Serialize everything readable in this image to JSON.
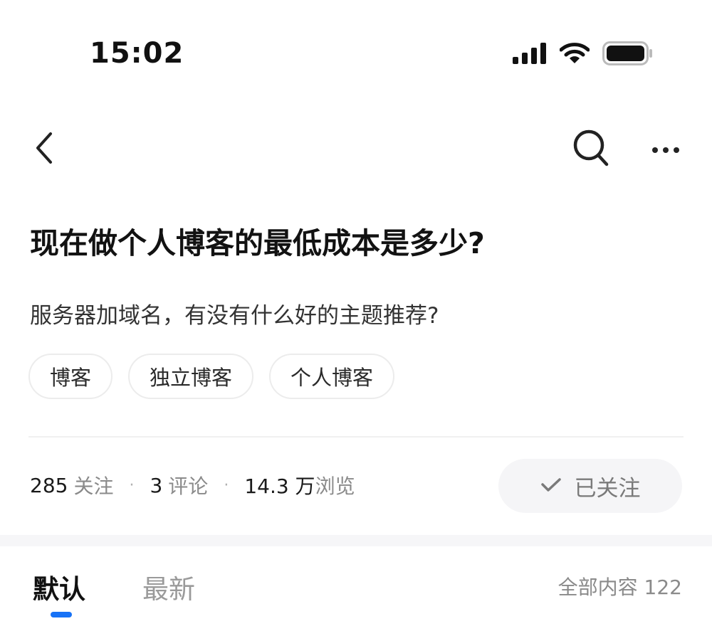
{
  "status_bar": {
    "time": "15:02",
    "icons": [
      "signal-icon",
      "wifi-icon",
      "battery-icon"
    ]
  },
  "nav": {
    "icons": [
      "back-arrow-icon",
      "search-icon",
      "more-icon"
    ]
  },
  "question": {
    "title": "现在做个人博客的最低成本是多少?",
    "description": "服务器加域名，有没有什么好的主题推荐?",
    "tags": [
      "博客",
      "独立博客",
      "个人博客"
    ]
  },
  "stats": {
    "followers_count": "285",
    "followers_label": "关注",
    "separator": "·",
    "comments_count": "3",
    "comments_label": "评论",
    "views_count": "14.3 万",
    "views_label": "浏览"
  },
  "follow_button": {
    "label": "已关注",
    "icon": "check-icon"
  },
  "tabs": {
    "default_label": "默认",
    "latest_label": "最新",
    "total_label": "全部内容 122"
  },
  "colors": {
    "accent": "#1772f6",
    "text_primary": "#121212",
    "text_secondary": "#8a8a8a",
    "button_bg": "#f5f5f7"
  }
}
